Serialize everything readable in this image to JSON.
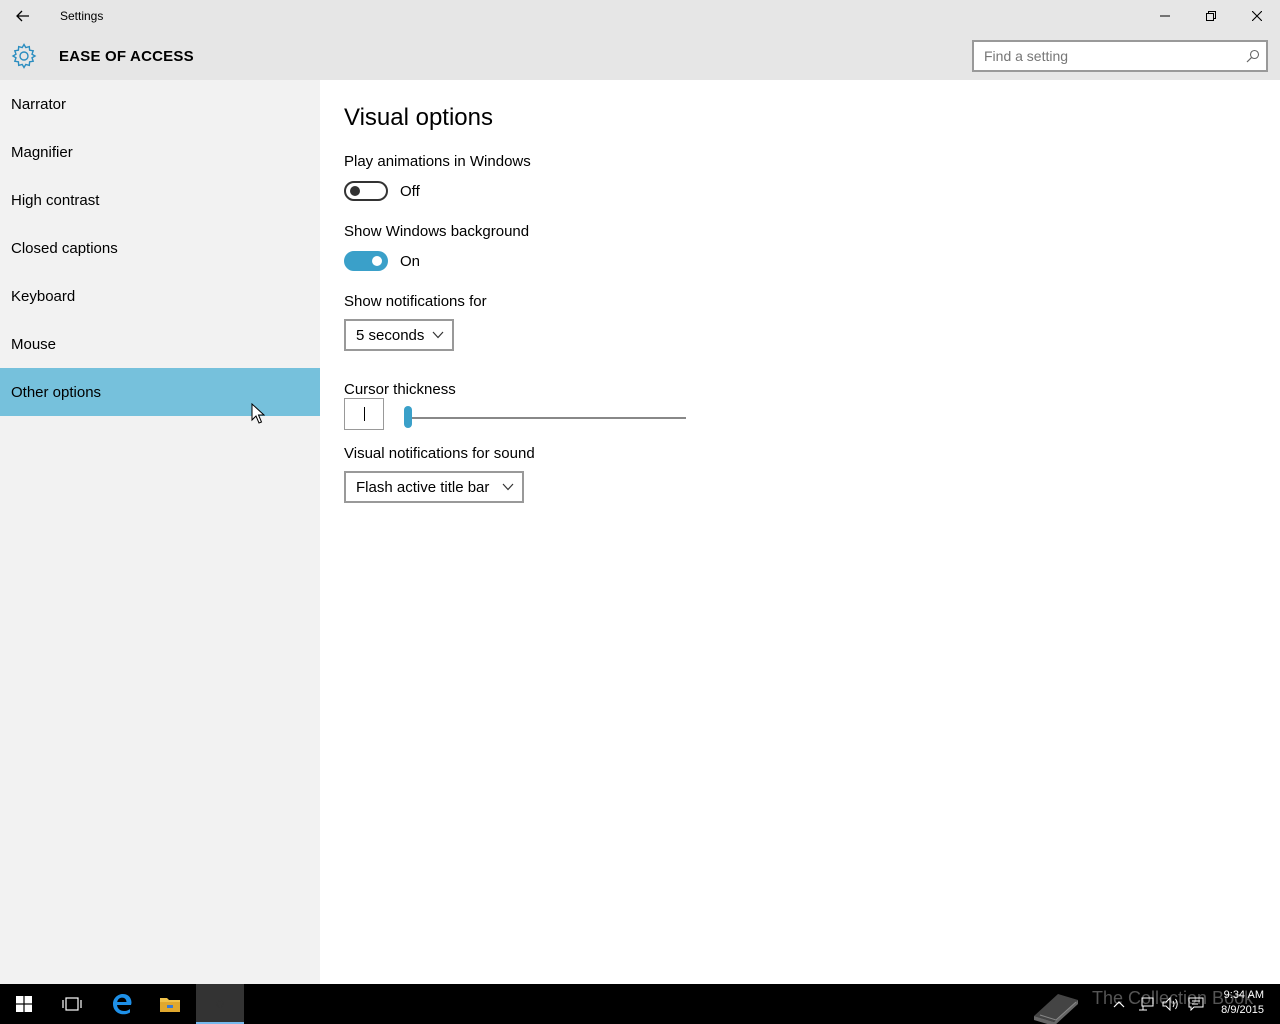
{
  "window": {
    "title": "Settings"
  },
  "header": {
    "section": "EASE OF ACCESS",
    "search_placeholder": "Find a setting"
  },
  "sidebar": {
    "items": [
      {
        "label": "Narrator",
        "selected": false
      },
      {
        "label": "Magnifier",
        "selected": false
      },
      {
        "label": "High contrast",
        "selected": false
      },
      {
        "label": "Closed captions",
        "selected": false
      },
      {
        "label": "Keyboard",
        "selected": false
      },
      {
        "label": "Mouse",
        "selected": false
      },
      {
        "label": "Other options",
        "selected": true
      }
    ]
  },
  "main": {
    "title": "Visual options",
    "animations": {
      "label": "Play animations in Windows",
      "state": "Off"
    },
    "background": {
      "label": "Show Windows background",
      "state": "On"
    },
    "notifications": {
      "label": "Show notifications for",
      "value": "5 seconds"
    },
    "cursor": {
      "label": "Cursor thickness",
      "slider_fraction": 0.0
    },
    "sound": {
      "label": "Visual notifications for sound",
      "value": "Flash active title bar"
    }
  },
  "taskbar": {
    "watermark": "The Collection Book",
    "time": "9:34 AM",
    "date": "8/9/2015"
  },
  "colors": {
    "accent": "#3aa0c9",
    "selected_nav": "#76c1dc",
    "chrome": "#e6e6e6",
    "sidebar_bg": "#f2f2f2"
  },
  "icons": [
    "back-arrow-icon",
    "minimize-icon",
    "maximize-icon",
    "close-icon",
    "gear-icon",
    "search-icon",
    "chevron-down-icon",
    "windows-start-icon",
    "task-view-icon",
    "edge-icon",
    "file-explorer-icon",
    "settings-icon",
    "book-icon",
    "chevron-up-icon",
    "network-icon",
    "volume-icon",
    "action-center-icon"
  ]
}
